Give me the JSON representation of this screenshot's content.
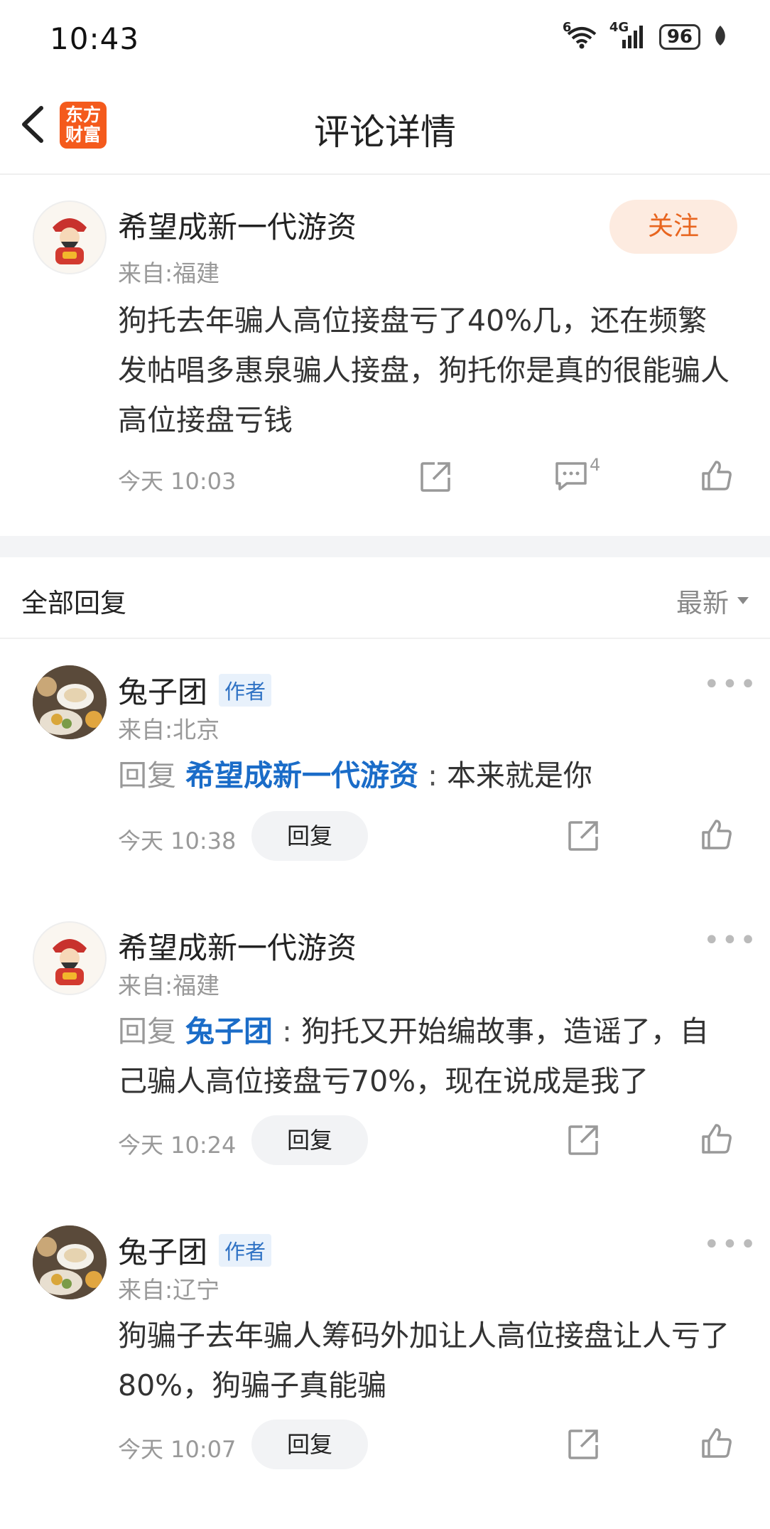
{
  "status_bar": {
    "time": "10:43",
    "wifi_label": "6",
    "network_label": "4G",
    "battery": "96"
  },
  "header": {
    "logo_line1": "东方",
    "logo_line2": "财富",
    "title": "评论详情"
  },
  "main_comment": {
    "author": "希望成新一代游资",
    "location": "来自:福建",
    "follow_label": "关注",
    "text": "狗托去年骗人高位接盘亏了40%几，还在频繁发帖唱多惠泉骗人接盘，狗托你是真的很能骗人高位接盘亏钱",
    "time": "今天 10:03",
    "comment_count": "4"
  },
  "replies_section": {
    "title": "全部回复",
    "sort_label": "最新"
  },
  "replies": [
    {
      "author": "兔子团",
      "tag": "作者",
      "location": "来自:北京",
      "reply_prefix": "回复",
      "reply_target": "希望成新一代游资",
      "separator": " : ",
      "text": "本来就是你",
      "time": "今天 10:38",
      "reply_button": "回复"
    },
    {
      "author": "希望成新一代游资",
      "location": "来自:福建",
      "reply_prefix": "回复",
      "reply_target": "兔子团",
      "separator": " : ",
      "text": "狗托又开始编故事，造谣了，自己骗人高位接盘亏70%，现在说成是我了",
      "time": "今天 10:24",
      "reply_button": "回复"
    },
    {
      "author": "兔子团",
      "tag": "作者",
      "location": "来自:辽宁",
      "text": "狗骗子去年骗人筹码外加让人高位接盘让人亏了80%，狗骗子真能骗",
      "time": "今天 10:07",
      "reply_button": "回复"
    }
  ],
  "colors": {
    "brand": "#f45a1c",
    "follow_text": "#e8651f",
    "link_blue": "#1a6cc8",
    "author_tag": "#2f72c4"
  }
}
